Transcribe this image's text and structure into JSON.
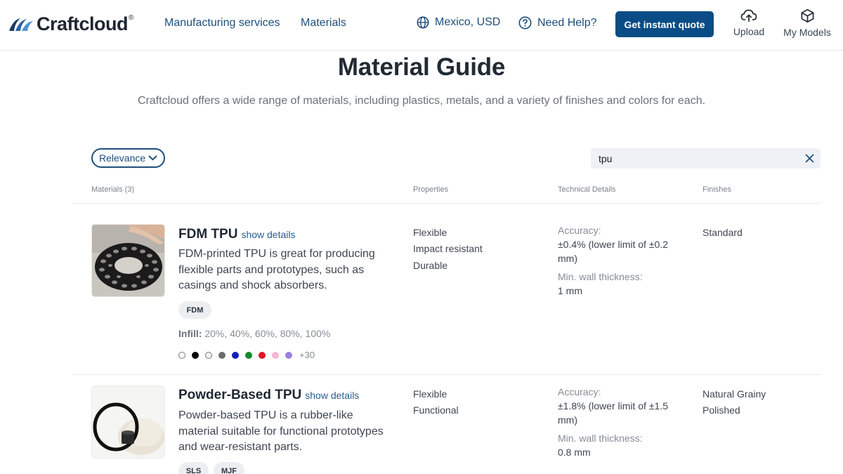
{
  "header": {
    "brand": "Craftcloud",
    "brand_mark": "®",
    "nav": [
      "Manufacturing services",
      "Materials"
    ],
    "region": "Mexico, USD",
    "help": "Need Help?",
    "cta": "Get instant quote",
    "upload": "Upload",
    "my_models": "My Models"
  },
  "page": {
    "title": "Material Guide",
    "subtitle": "Craftcloud offers a wide range of materials, including plastics, metals, and a variety of finishes and colors for each."
  },
  "controls": {
    "sort_label": "Relevance",
    "search_value": "tpu"
  },
  "table": {
    "headers": {
      "materials": "Materials (3)",
      "properties": "Properties",
      "technical": "Technical Details",
      "finishes": "Finishes"
    }
  },
  "materials": [
    {
      "name": "FDM TPU",
      "link": "show details",
      "description": "FDM-printed TPU is great for producing flexible parts and prototypes, such as casings and shock absorbers.",
      "tags": [
        "FDM"
      ],
      "infill_label": "Infill:",
      "infill_values": "20%, 40%, 60%, 80%, 100%",
      "colors": [
        "#ffffff",
        "#000000",
        "#f2f2f2",
        "#6d6d6d",
        "#1222b8",
        "#118c2b",
        "#e01422",
        "#f7b6d6",
        "#9b7fe0"
      ],
      "more_colors": "+30",
      "properties": [
        "Flexible",
        "Impact resistant",
        "Durable"
      ],
      "accuracy_label": "Accuracy:",
      "accuracy_value": "±0.4% (lower limit of ±0.2 mm)",
      "wall_label": "Min. wall thickness:",
      "wall_value": "1 mm",
      "finishes": [
        "Standard"
      ]
    },
    {
      "name": "Powder-Based TPU",
      "link": "show details",
      "description": "Powder-based TPU is a rubber-like material suitable for functional prototypes and wear-resistant parts.",
      "tags": [
        "SLS",
        "MJF"
      ],
      "properties": [
        "Flexible",
        "Functional"
      ],
      "accuracy_label": "Accuracy:",
      "accuracy_value": "±1.8% (lower limit of ±1.5 mm)",
      "wall_label": "Min. wall thickness:",
      "wall_value": "0.8 mm",
      "finishes": [
        "Natural Grainy",
        "Polished"
      ]
    }
  ],
  "icons": {
    "logo": "craftcloud-wave-logo",
    "globe": "globe-icon",
    "help": "question-circle-icon",
    "upload": "cloud-upload-icon",
    "models": "cube-icon",
    "chevron": "chevron-down-icon",
    "clear": "close-icon"
  },
  "colors": {
    "brand_blue": "#0a4c86",
    "link_blue": "#1e4e7a",
    "text_dark": "#1f2733",
    "text_muted": "#858c95"
  }
}
